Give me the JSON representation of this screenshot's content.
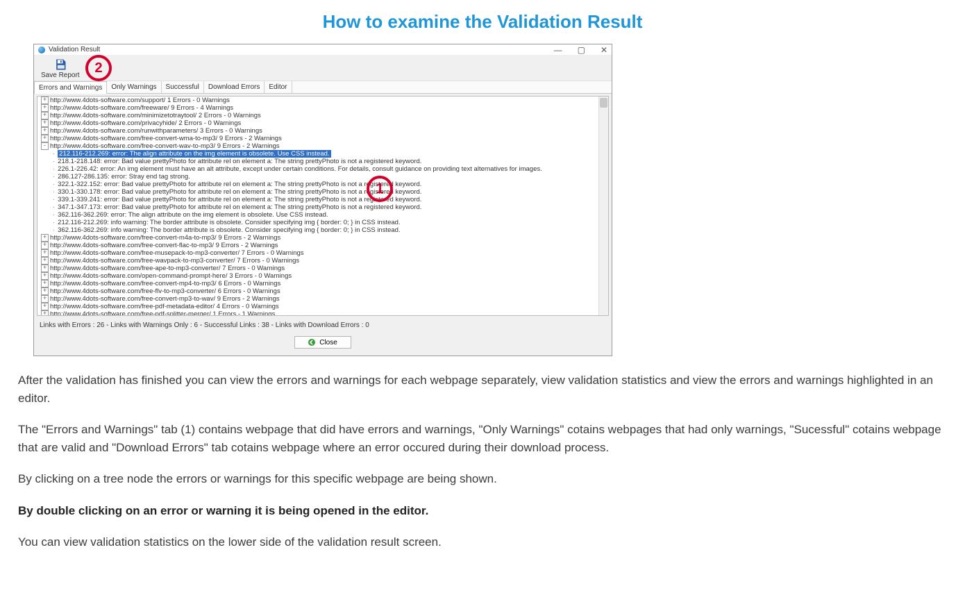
{
  "heading": "How to examine the Validation Result",
  "window": {
    "title": "Validation Result",
    "controls": {
      "min": "—",
      "max": "▢",
      "close": "✕"
    }
  },
  "toolbar": {
    "save_label": "Save Report"
  },
  "tabs": [
    "Errors and Warnings",
    "Only Warnings",
    "Successful",
    "Download Errors",
    "Editor"
  ],
  "tree_top": [
    "http://www.4dots-software.com/support/ 1 Errors - 0 Warnings",
    "http://www.4dots-software.com/freeware/ 9 Errors - 4 Warnings",
    "http://www.4dots-software.com/minimizetotraytool/ 2 Errors - 0 Warnings",
    "http://www.4dots-software.com/privacyhide/ 2 Errors - 0 Warnings",
    "http://www.4dots-software.com/runwithparameters/ 3 Errors - 0 Warnings",
    "http://www.4dots-software.com/free-convert-wma-to-mp3/ 9 Errors - 2 Warnings"
  ],
  "tree_expanded_label": "http://www.4dots-software.com/free-convert-wav-to-mp3/ 9 Errors - 2 Warnings",
  "tree_details": [
    {
      "sel": true,
      "t": "212.116-212.269: error: The align attribute on the img element is obsolete. Use CSS instead."
    },
    {
      "sel": false,
      "t": "218.1-218.148: error: Bad value prettyPhoto for attribute rel on element a: The string prettyPhoto is not a registered keyword."
    },
    {
      "sel": false,
      "t": "226.1-226.42: error: An img element must have an alt attribute, except under certain conditions. For details, consult guidance on providing text alternatives for images."
    },
    {
      "sel": false,
      "t": "286.127-286.135: error: Stray end tag strong."
    },
    {
      "sel": false,
      "t": "322.1-322.152: error: Bad value prettyPhoto for attribute rel on element a: The string prettyPhoto is not a registered keyword."
    },
    {
      "sel": false,
      "t": "330.1-330.178: error: Bad value prettyPhoto for attribute rel on element a: The string prettyPhoto is not a registered keyword."
    },
    {
      "sel": false,
      "t": "339.1-339.241: error: Bad value prettyPhoto for attribute rel on element a: The string prettyPhoto is not a registered keyword."
    },
    {
      "sel": false,
      "t": "347.1-347.173: error: Bad value prettyPhoto for attribute rel on element a: The string prettyPhoto is not a registered keyword."
    },
    {
      "sel": false,
      "t": "362.116-362.269: error: The align attribute on the img element is obsolete. Use CSS instead."
    },
    {
      "sel": false,
      "t": "212.116-212.269: info warning: The border attribute is obsolete. Consider specifying img { border: 0; } in CSS instead."
    },
    {
      "sel": false,
      "t": "362.116-362.269: info warning: The border attribute is obsolete. Consider specifying img { border: 0; } in CSS instead."
    }
  ],
  "tree_bottom": [
    "http://www.4dots-software.com/free-convert-m4a-to-mp3/ 9 Errors - 2 Warnings",
    "http://www.4dots-software.com/free-convert-flac-to-mp3/ 9 Errors - 2 Warnings",
    "http://www.4dots-software.com/free-musepack-to-mp3-converter/ 7 Errors - 0 Warnings",
    "http://www.4dots-software.com/free-wavpack-to-mp3-converter/ 7 Errors - 0 Warnings",
    "http://www.4dots-software.com/free-ape-to-mp3-converter/ 7 Errors - 0 Warnings",
    "http://www.4dots-software.com/open-command-prompt-here/ 3 Errors - 0 Warnings",
    "http://www.4dots-software.com/free-convert-mp4-to-mp3/ 6 Errors - 0 Warnings",
    "http://www.4dots-software.com/free-flv-to-mp3-converter/ 6 Errors - 0 Warnings",
    "http://www.4dots-software.com/free-convert-mp3-to-wav/ 9 Errors - 2 Warnings",
    "http://www.4dots-software.com/free-pdf-metadata-editor/ 4 Errors - 0 Warnings",
    "http://www.4dots-software.com/free-pdf-splitter-merger/ 1 Errors - 1 Warnings"
  ],
  "status": "Links with Errors : 26 - Links with Warnings Only : 6 - Successful Links : 38 - Links with Download Errors : 0",
  "close_label": "Close",
  "callouts": {
    "c1": "1",
    "c2": "2"
  },
  "paragraphs": [
    {
      "bold": false,
      "t": "After the validation has finished you can view the errors and warnings for each webpage separately, view validation statistics and view the errors and warnings highlighted in an editor."
    },
    {
      "bold": false,
      "t": "The \"Errors and Warnings\" tab (1) contains webpage that did have errors and warnings, \"Only Warnings\" cotains webpages that had only warnings, \"Sucessful\" cotains webpage that are valid and \"Download Errors\" tab cotains webpage where an error occured during their download process."
    },
    {
      "bold": false,
      "t": "By clicking on a tree node the errors or warnings for this specific webpage are being shown."
    },
    {
      "bold": true,
      "t": "By double clicking on an error or warning it is being opened in the editor."
    },
    {
      "bold": false,
      "t": "You can view validation statistics on the lower side of the validation result screen."
    }
  ]
}
